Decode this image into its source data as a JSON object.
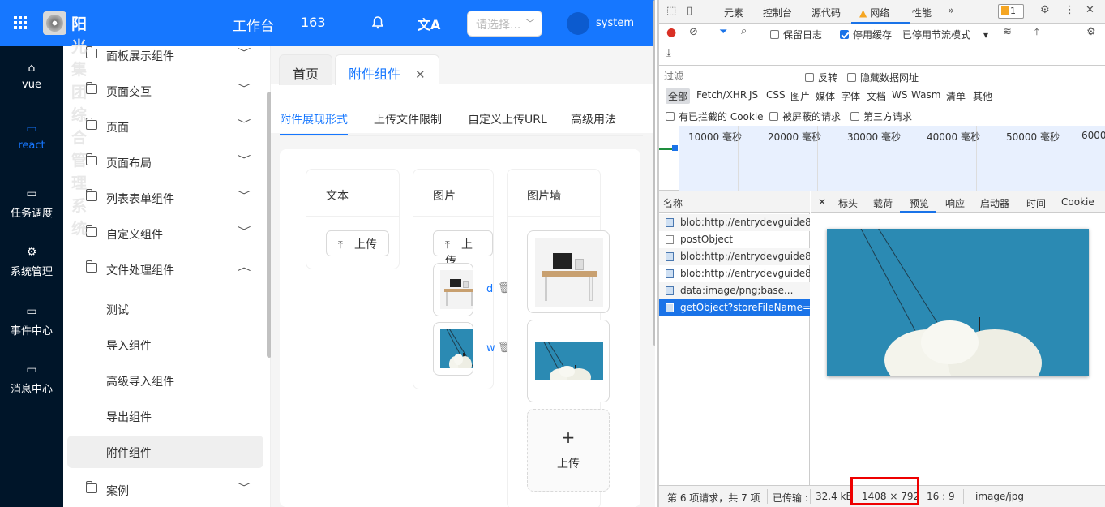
{
  "app": {
    "title_chars": [
      "阳",
      "光",
      "集",
      "团",
      "综",
      "合",
      "管",
      "理",
      "系",
      "统"
    ],
    "top_links": [
      "工作台",
      "163"
    ],
    "select_placeholder": "请选择...",
    "user": "system",
    "brand_color": "#1677ff",
    "rail": [
      {
        "label": "vue",
        "icon": "bank-icon",
        "glyph": "⌂",
        "active": false
      },
      {
        "label": "react",
        "icon": "folder-open-icon",
        "glyph": "▭",
        "active": true
      },
      {
        "label": "任务调度",
        "icon": "folder-icon",
        "glyph": "▭",
        "active": false
      },
      {
        "label": "系统管理",
        "icon": "gear-icon",
        "glyph": "⚙",
        "active": false
      },
      {
        "label": "事件中心",
        "icon": "folder-icon",
        "glyph": "▭",
        "active": false
      },
      {
        "label": "消息中心",
        "icon": "folder-icon",
        "glyph": "▭",
        "active": false
      }
    ],
    "submenu": [
      {
        "label": "面板展示组件",
        "expanded": false
      },
      {
        "label": "页面交互",
        "expanded": false
      },
      {
        "label": "页面",
        "expanded": false
      },
      {
        "label": "页面布局",
        "expanded": false
      },
      {
        "label": "列表表单组件",
        "expanded": false
      },
      {
        "label": "自定义组件",
        "expanded": false
      },
      {
        "label": "文件处理组件",
        "expanded": true
      }
    ],
    "submenu_children": [
      "测试",
      "导入组件",
      "高级导入组件",
      "导出组件",
      "附件组件"
    ],
    "submenu_active_child": "附件组件",
    "submenu_after": [
      "案例"
    ],
    "page_tabs": [
      {
        "label": "首页",
        "active": false,
        "closable": false
      },
      {
        "label": "附件组件",
        "active": true,
        "closable": true
      }
    ],
    "content_tabs": [
      "附件展现形式",
      "上传文件限制",
      "自定义上传URL",
      "高级用法"
    ],
    "content_tab_active": "附件展现形式",
    "columns": {
      "text": {
        "title": "文本",
        "upload_label": "上传"
      },
      "picture": {
        "title": "图片",
        "upload_label": "上传",
        "files": [
          {
            "name_fragment": "d"
          },
          {
            "name_fragment": "w"
          }
        ]
      },
      "wall": {
        "title": "图片墙",
        "add_label": "上传"
      }
    }
  },
  "devtools": {
    "tabs": [
      "元素",
      "控制台",
      "源代码",
      "网络",
      "性能"
    ],
    "active_tab": "网络",
    "issues_count": "1",
    "toolbar": {
      "preserve_log": "保留日志",
      "disable_cache": "停用缓存",
      "throttle": "已停用节流模式"
    },
    "filter_placeholder": "过滤",
    "invert": "反转",
    "hide_data_urls": "隐藏数据网址",
    "filter_types": [
      "全部",
      "Fetch/XHR",
      "JS",
      "CSS",
      "图片",
      "媒体",
      "字体",
      "文档",
      "WS",
      "Wasm",
      "清单",
      "其他"
    ],
    "filter_type_active": "全部",
    "filter_checks": [
      "有已拦截的 Cookie",
      "被屏蔽的请求",
      "第三方请求"
    ],
    "timeline_labels": [
      "10000 毫秒",
      "20000 毫秒",
      "30000 毫秒",
      "40000 毫秒",
      "50000 毫秒",
      "6000"
    ],
    "name_header": "名称",
    "requests": [
      {
        "name": "blob:http://entrydevguide8...",
        "kind": "img"
      },
      {
        "name": "postObject",
        "kind": "doc"
      },
      {
        "name": "blob:http://entrydevguide8...",
        "kind": "img"
      },
      {
        "name": "blob:http://entrydevguide8...",
        "kind": "img"
      },
      {
        "name": "data:image/png;base...",
        "kind": "img"
      },
      {
        "name": "getObject?storeFileName=...",
        "kind": "img"
      }
    ],
    "selected_request": 5,
    "detail_tabs": [
      "标头",
      "载荷",
      "预览",
      "响应",
      "启动器",
      "时间",
      "Cookie"
    ],
    "detail_active": "预览",
    "status": {
      "requests": "第 6 项请求，共 7 项",
      "transferred": "已传输 :",
      "size": "32.4 kB",
      "dims": "1408 × 792",
      "ratio": "16 : 9",
      "mime": "image/jpg"
    },
    "highlight_color": "#e00000"
  }
}
